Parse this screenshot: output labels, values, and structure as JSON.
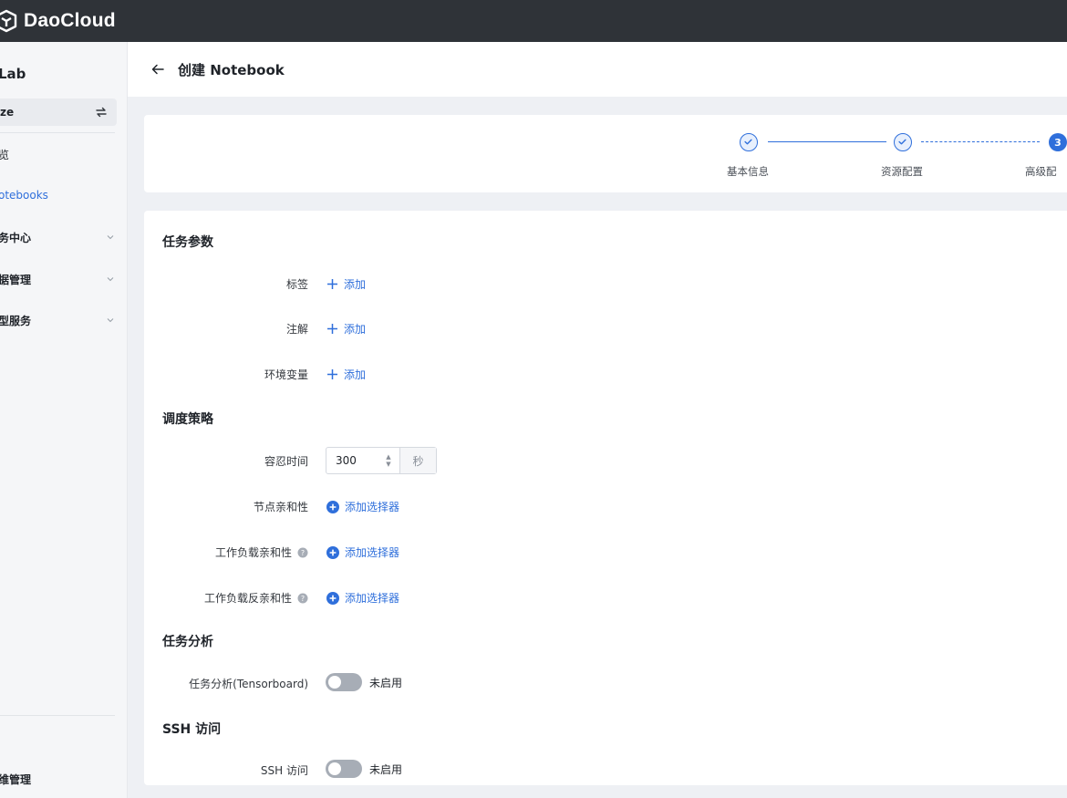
{
  "brand": {
    "name": "DaoCloud"
  },
  "sidebar": {
    "title": "Lab",
    "workspace": "ze",
    "items": [
      {
        "label": "览"
      },
      {
        "label": "otebooks"
      },
      {
        "label": "务中心"
      },
      {
        "label": "据管理"
      },
      {
        "label": "型服务"
      }
    ],
    "bottom_item": "维管理"
  },
  "header": {
    "title": "创建 Notebook"
  },
  "steps": [
    {
      "label": "基本信息",
      "status": "done"
    },
    {
      "label": "资源配置",
      "status": "done"
    },
    {
      "label": "高级配",
      "status": "current",
      "number": "3"
    }
  ],
  "form": {
    "task_params": {
      "title": "任务参数",
      "rows": [
        {
          "label": "标签",
          "action": "添加"
        },
        {
          "label": "注解",
          "action": "添加"
        },
        {
          "label": "环境变量",
          "action": "添加"
        }
      ]
    },
    "scheduling": {
      "title": "调度策略",
      "tolerance": {
        "label": "容忍时间",
        "value": "300",
        "unit": "秒"
      },
      "node_affinity": {
        "label": "节点亲和性",
        "action": "添加选择器"
      },
      "workload_affinity": {
        "label": "工作负载亲和性",
        "action": "添加选择器"
      },
      "workload_anti_affinity": {
        "label": "工作负载反亲和性",
        "action": "添加选择器"
      }
    },
    "analysis": {
      "title": "任务分析",
      "label": "任务分析(Tensorboard)",
      "state": "未启用",
      "enabled": false
    },
    "ssh": {
      "title": "SSH 访问",
      "label": "SSH 访问",
      "state": "未启用",
      "enabled": false
    }
  },
  "colors": {
    "accent": "#2f6fdb",
    "topbar": "#2f3338",
    "toggle_off": "#a7adb6"
  }
}
